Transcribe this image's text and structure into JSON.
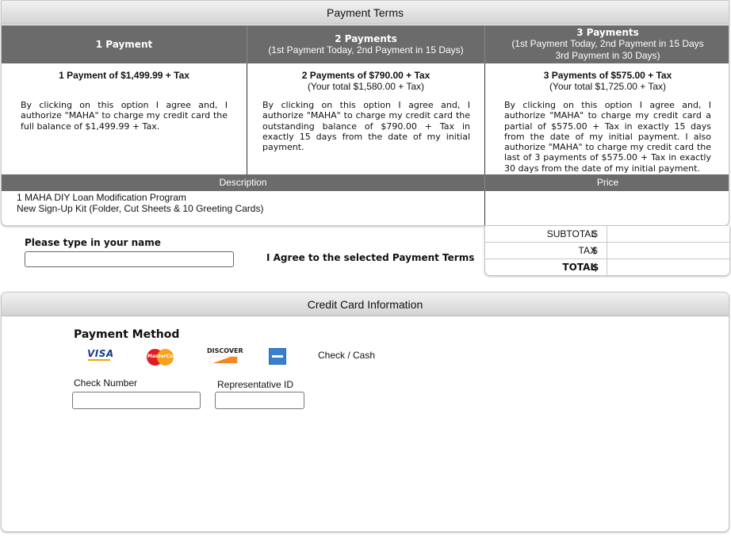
{
  "payment_terms": {
    "title": "Payment Terms",
    "options": [
      {
        "header": "1 Payment",
        "header_sub": [],
        "title": "1 Payment of $1,499.99 + Tax",
        "subtitle": "",
        "text": "By clicking on this option I agree and, I authorize \"MAHA\" to charge my credit card the full balance of $1,499.99 + Tax."
      },
      {
        "header": "2 Payments",
        "header_sub": [
          "(1st Payment Today, 2nd Payment in 15 Days)"
        ],
        "title": "2 Payments of $790.00 + Tax",
        "subtitle": "(Your total $1,580.00 + Tax)",
        "text": "By clicking on this option I agree and, I authorize \"MAHA\" to charge my credit card the outstanding balance of $790.00 + Tax in exactly 15 days from the date of my initial payment."
      },
      {
        "header": "3 Payments",
        "header_sub": [
          "(1st Payment Today, 2nd Payment in 15 Days",
          "3rd Payment in 30 Days)"
        ],
        "title": "3 Payments of $575.00 + Tax",
        "subtitle": "(Your total $1,725.00 + Tax)",
        "text": "By clicking on this option I agree and, I authorize \"MAHA\" to charge my credit card a partial of $575.00 + Tax in exactly 15 days from the date of my initial payment. I also authorize \"MAHA\" to charge my credit card the last of 3 payments of $575.00 + Tax in exactly 30 days from the date of my initial payment."
      }
    ],
    "description_header": "Description",
    "price_header": "Price",
    "description_lines": [
      "1 MAHA DIY Loan Modification Program",
      "New Sign-Up Kit (Folder, Cut Sheets & 10 Greeting Cards)"
    ]
  },
  "agreement": {
    "name_label": "Please type in your name",
    "name_value": "",
    "agree_text": "I Agree to the selected Payment Terms"
  },
  "totals": [
    {
      "label": "SUBTOTAL",
      "currency": "$",
      "value": ""
    },
    {
      "label": "TAX",
      "currency": "$",
      "value": ""
    },
    {
      "label": "TOTAL",
      "currency": "$",
      "value": ""
    }
  ],
  "credit_card": {
    "title": "Credit Card Information",
    "payment_method_label": "Payment Method",
    "cards": [
      {
        "name": "visa-icon",
        "text": "VISA"
      },
      {
        "name": "mastercard-icon",
        "text": "MasterCard"
      },
      {
        "name": "discover-icon",
        "text": "DISCOVER"
      },
      {
        "name": "amex-icon",
        "text": ""
      }
    ],
    "check_cash_label": "Check / Cash",
    "check_number_label": "Check Number",
    "check_number_value": "",
    "rep_id_label": "Representative ID",
    "rep_id_value": ""
  }
}
